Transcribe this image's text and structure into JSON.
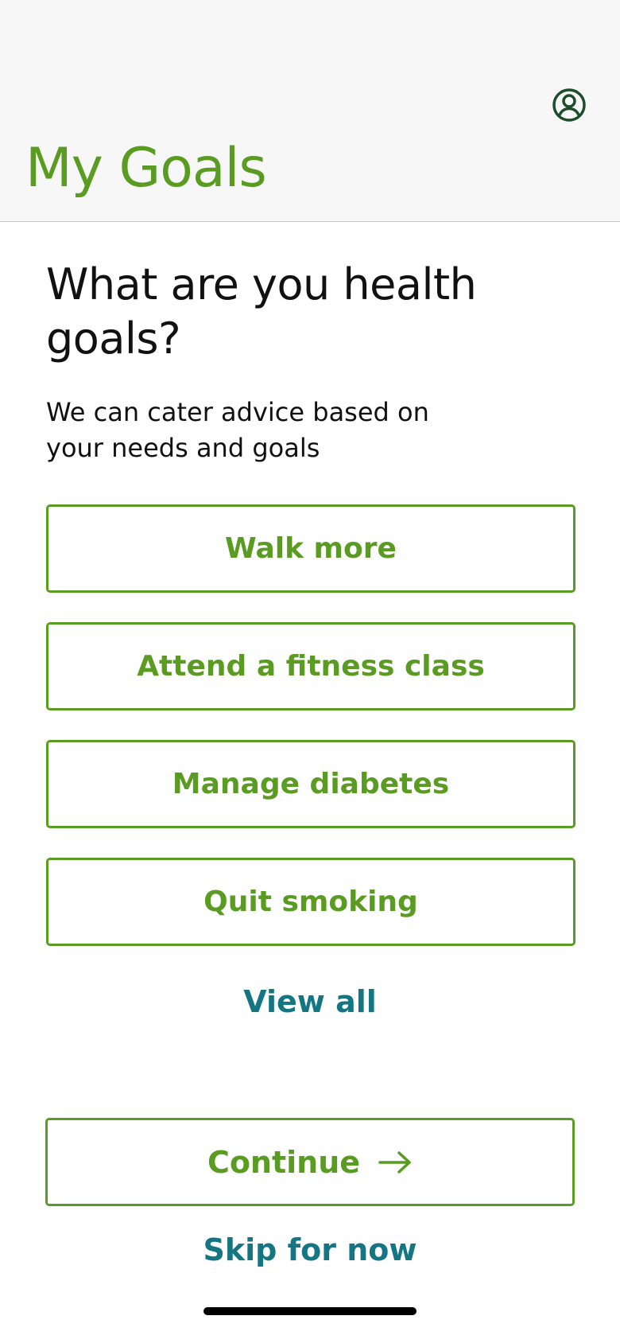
{
  "header": {
    "title": "My Goals",
    "profile_icon": "user-circle-icon"
  },
  "main": {
    "heading": "What are you health goals?",
    "subtext": "We can cater advice based on your needs and goals",
    "goals": [
      {
        "label": "Walk more"
      },
      {
        "label": "Attend a fitness class"
      },
      {
        "label": "Manage diabetes"
      },
      {
        "label": "Quit smoking"
      }
    ],
    "view_all_label": "View all"
  },
  "footer": {
    "continue_label": "Continue",
    "continue_icon": "arrow-right-icon",
    "skip_label": "Skip for now"
  },
  "colors": {
    "accent_green": "#5a9c21",
    "link_teal": "#147682",
    "icon_dark_green": "#1d4d2a",
    "header_bg": "#f7f7f7"
  }
}
